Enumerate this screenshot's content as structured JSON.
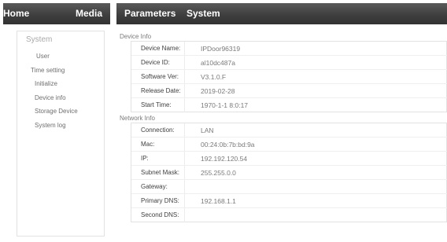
{
  "nav": {
    "items": [
      {
        "label": "Home"
      },
      {
        "label": "Media"
      },
      {
        "label": "Parameters"
      },
      {
        "label": "System"
      }
    ]
  },
  "sidebar": {
    "title": "System",
    "items": [
      {
        "label": "User"
      },
      {
        "label": "Time setting"
      },
      {
        "label": "Initialize"
      },
      {
        "label": "Device info"
      },
      {
        "label": "Storage Device"
      },
      {
        "label": "System log"
      }
    ]
  },
  "device_info": {
    "title": "Device Info",
    "rows": [
      {
        "key": "Device Name:",
        "value": "IPDoor96319"
      },
      {
        "key": "Device ID:",
        "value": "al10dc487a"
      },
      {
        "key": "Software Ver:",
        "value": "V3.1.0.F"
      },
      {
        "key": "Release Date:",
        "value": "2019-02-28"
      },
      {
        "key": "Start Time:",
        "value": "1970-1-1 8:0:17"
      }
    ]
  },
  "network_info": {
    "title": "Network Info",
    "rows": [
      {
        "key": "Connection:",
        "value": "LAN"
      },
      {
        "key": "Mac:",
        "value": "00:24:0b:7b:bd:9a"
      },
      {
        "key": "IP:",
        "value": "192.192.120.54"
      },
      {
        "key": "Subnet Mask:",
        "value": "255.255.0.0"
      },
      {
        "key": "Gateway:",
        "value": ""
      },
      {
        "key": "Primary DNS:",
        "value": "192.168.1.1"
      },
      {
        "key": "Second DNS:",
        "value": ""
      }
    ]
  }
}
